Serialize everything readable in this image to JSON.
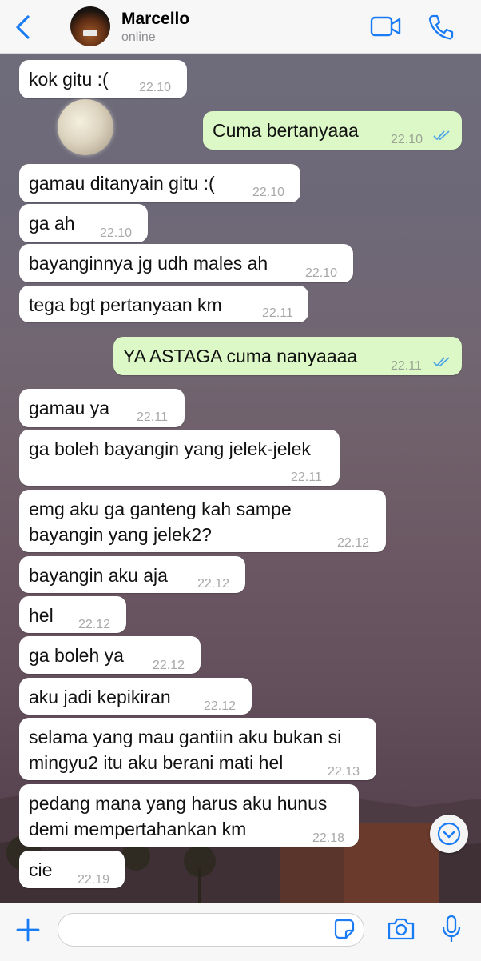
{
  "header": {
    "contact_name": "Marcello",
    "contact_status": "online"
  },
  "colors": {
    "accent": "#1a7cf5",
    "incoming_bubble": "#ffffff",
    "outgoing_bubble": "#dcf8c6",
    "read_ticks": "#4fa5e8"
  },
  "icons": {
    "back": "chevron-left-icon",
    "video": "video-call-icon",
    "phone": "phone-icon",
    "scroll": "chevron-down-icon",
    "attach": "plus-icon",
    "sticker": "sticker-icon",
    "camera": "camera-icon",
    "mic": "microphone-icon"
  },
  "messages": [
    {
      "dir": "in",
      "text": "kok gitu :(",
      "time": "22.10"
    },
    {
      "dir": "out",
      "text": "Cuma bertanyaaa",
      "time": "22.10",
      "read": true
    },
    {
      "dir": "in",
      "text": "gamau ditanyain gitu :(",
      "time": "22.10"
    },
    {
      "dir": "in",
      "text": "ga ah",
      "time": "22.10"
    },
    {
      "dir": "in",
      "text": "bayanginnya jg udh males ah",
      "time": "22.10"
    },
    {
      "dir": "in",
      "text": "tega bgt pertanyaan km",
      "time": "22.11"
    },
    {
      "dir": "out",
      "text": "YA ASTAGA cuma nanyaaaa",
      "time": "22.11",
      "read": true
    },
    {
      "dir": "in",
      "text": "gamau ya",
      "time": "22.11"
    },
    {
      "dir": "in",
      "text": "ga boleh bayangin yang jelek-jelek",
      "time": "22.11"
    },
    {
      "dir": "in",
      "text_line1": "emg aku ga ganteng kah sampe",
      "text_line2": "bayangin yang jelek2?",
      "time": "22.12"
    },
    {
      "dir": "in",
      "text": "bayangin aku aja",
      "time": "22.12"
    },
    {
      "dir": "in",
      "text": "hel",
      "time": "22.12"
    },
    {
      "dir": "in",
      "text": "ga boleh ya",
      "time": "22.12"
    },
    {
      "dir": "in",
      "text": "aku jadi kepikiran",
      "time": "22.12"
    },
    {
      "dir": "in",
      "text_line1": "selama yang mau gantiin aku bukan si",
      "text_line2": "mingyu2 itu aku berani mati hel",
      "time": "22.13"
    },
    {
      "dir": "in",
      "text_line1": "pedang mana yang harus aku hunus",
      "text_line2": "demi mempertahankan km",
      "time": "22.18"
    },
    {
      "dir": "in",
      "text": "cie",
      "time": "22.19"
    }
  ],
  "input": {
    "placeholder": ""
  }
}
